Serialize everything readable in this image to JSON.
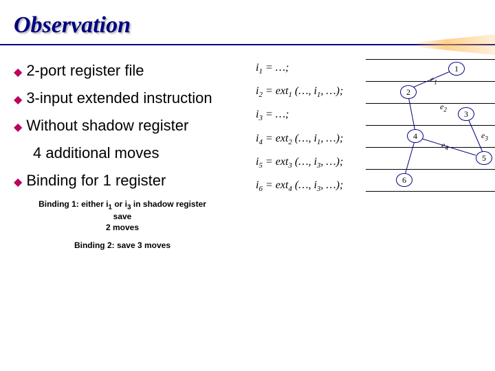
{
  "title": "Observation",
  "bullets": {
    "b1": "2-port register file",
    "b2": "3-input extended instruction",
    "b3": "Without shadow register",
    "sub1": "4 additional moves",
    "b4": "Binding for 1 register"
  },
  "notes": {
    "binding1_a": "Binding 1: either i",
    "binding1_b": " or i",
    "binding1_c": " in shadow register save",
    "binding1_d": "2 moves",
    "binding1_sub1": "1",
    "binding1_sub2": "3",
    "binding2": "Binding 2: save 3 moves"
  },
  "equations": {
    "e1_a": "i",
    "e1_b": " = …;",
    "e2_a": "i",
    "e2_b": " = ext",
    "e2_c": " (…, i",
    "e2_d": ", …);",
    "e3_a": "i",
    "e3_b": " = …;",
    "e4_a": "i",
    "e4_b": " = ext",
    "e4_c": " (…, i",
    "e4_d": ", …);",
    "e5_a": "i",
    "e5_b": " = ext",
    "e5_c": " (…, i",
    "e5_d": ", …);",
    "e6_a": "i",
    "e6_b": " = ext",
    "e6_c": " (…, i",
    "e6_d": ", …);",
    "sub": {
      "s1": "1",
      "s2": "2",
      "s3": "3",
      "s4": "4",
      "s5": "5",
      "s6": "6"
    }
  },
  "nodes": {
    "n1": "1",
    "n2": "2",
    "n3": "3",
    "n4": "4",
    "n5": "5",
    "n6": "6"
  },
  "edgeLabels": {
    "e1_a": "e",
    "e1_b": "1",
    "e2_a": "e",
    "e2_b": "2",
    "e3_a": "e",
    "e3_b": "3",
    "e4_a": "e",
    "e4_b": "4"
  }
}
